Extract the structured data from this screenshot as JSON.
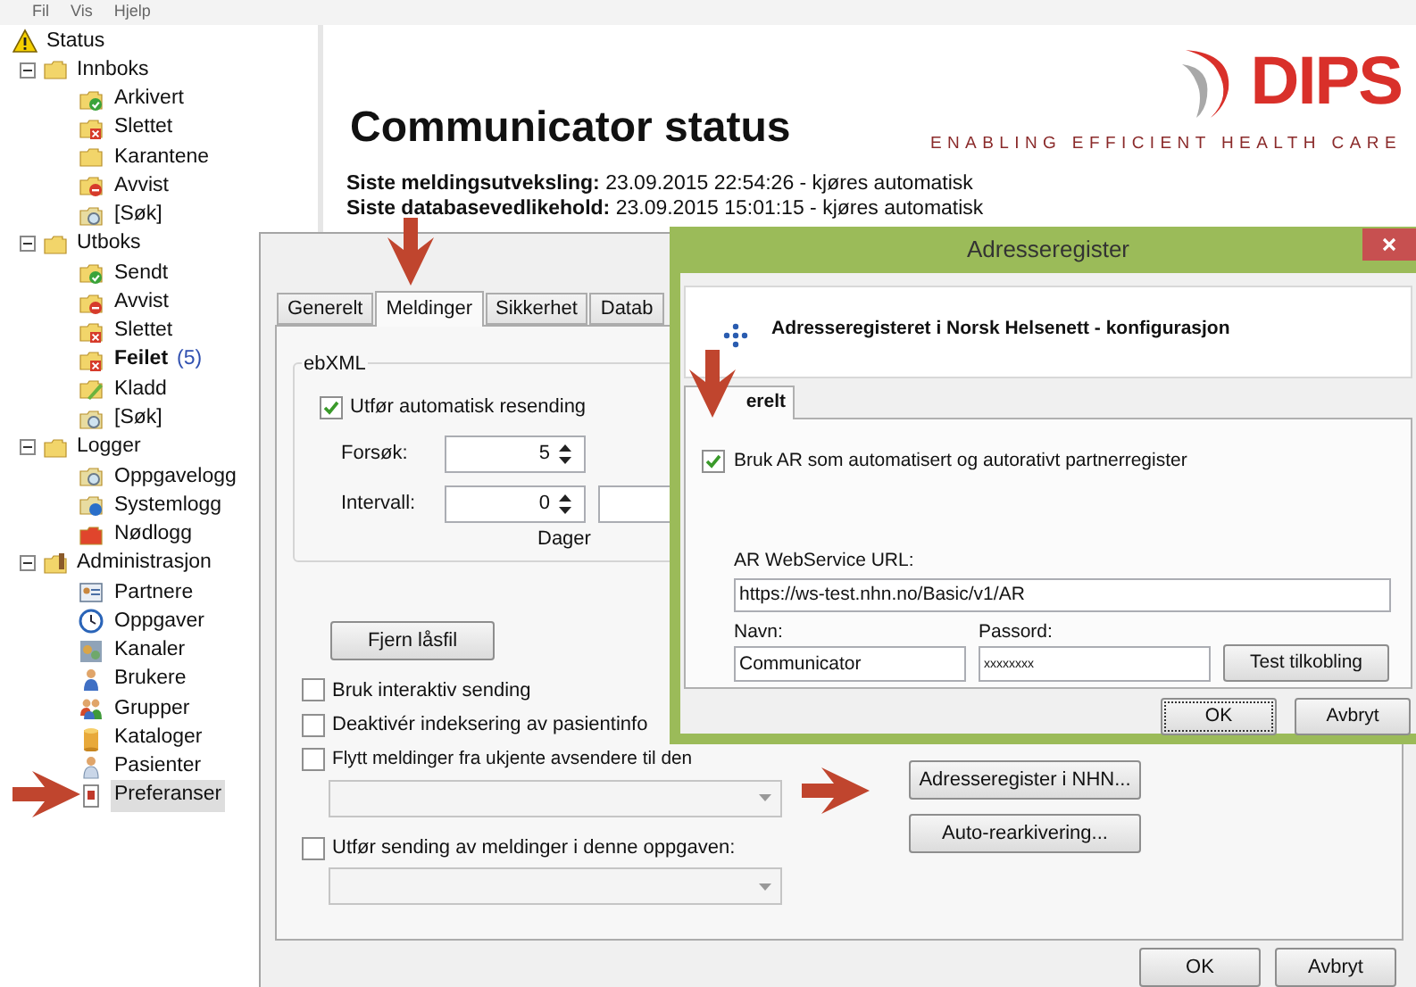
{
  "menu": [
    "Fil",
    "Vis",
    "Hjelp"
  ],
  "tree": [
    {
      "label": "Status",
      "kind": "warning",
      "selected": false,
      "bold": false
    },
    {
      "label": "Innboks",
      "kind": "folder",
      "selected": false,
      "bold": false,
      "expanded": true,
      "children": [
        {
          "label": "Arkivert",
          "kind": "check",
          "selected": false,
          "bold": false
        },
        {
          "label": "Slettet",
          "kind": "cross",
          "selected": false,
          "bold": false
        },
        {
          "label": "Karantene",
          "kind": "folder",
          "selected": false,
          "bold": false
        },
        {
          "label": "Avvist",
          "kind": "minus",
          "selected": false,
          "bold": false
        },
        {
          "label": "[Søk]",
          "kind": "search",
          "selected": false,
          "bold": false
        }
      ]
    },
    {
      "label": "Utboks",
      "kind": "folder",
      "selected": false,
      "bold": false,
      "expanded": true,
      "children": [
        {
          "label": "Sendt",
          "kind": "check",
          "selected": false,
          "bold": false
        },
        {
          "label": "Avvist",
          "kind": "minus",
          "selected": false,
          "bold": false
        },
        {
          "label": "Slettet",
          "kind": "cross",
          "selected": false,
          "bold": false
        },
        {
          "label": "Feilet",
          "kind": "cross",
          "selected": false,
          "bold": true,
          "count": "(5)"
        },
        {
          "label": "Kladd",
          "kind": "edit",
          "selected": false,
          "bold": false
        },
        {
          "label": "[Søk]",
          "kind": "search",
          "selected": false,
          "bold": false
        }
      ]
    },
    {
      "label": "Logger",
      "kind": "folder",
      "selected": false,
      "bold": false,
      "expanded": true,
      "children": [
        {
          "label": "Oppgavelogg",
          "kind": "search",
          "selected": false,
          "bold": false
        },
        {
          "label": "Systemlogg",
          "kind": "info",
          "selected": false,
          "bold": false
        },
        {
          "label": "Nødlogg",
          "kind": "alert",
          "selected": false,
          "bold": false
        }
      ]
    },
    {
      "label": "Administrasjon",
      "kind": "admin",
      "selected": false,
      "bold": false,
      "expanded": true,
      "children": [
        {
          "label": "Partnere",
          "kind": "card",
          "selected": false,
          "bold": false
        },
        {
          "label": "Oppgaver",
          "kind": "clock",
          "selected": false,
          "bold": false
        },
        {
          "label": "Kanaler",
          "kind": "network",
          "selected": false,
          "bold": false
        },
        {
          "label": "Brukere",
          "kind": "user",
          "selected": false,
          "bold": false
        },
        {
          "label": "Grupper",
          "kind": "group",
          "selected": false,
          "bold": false
        },
        {
          "label": "Kataloger",
          "kind": "cylinder",
          "selected": false,
          "bold": false
        },
        {
          "label": "Pasienter",
          "kind": "patient",
          "selected": false,
          "bold": false
        },
        {
          "label": "Preferanser",
          "kind": "document",
          "selected": true,
          "bold": false
        }
      ]
    }
  ],
  "status_page": {
    "title": "Communicator status",
    "logo": "DIPS",
    "tagline": "ENABLING EFFICIENT HEALTH CARE",
    "lines": [
      "**Siste meldingsutveksling:** 23.09.2015 22:54:26 - kjøres automatisk",
      "**Siste databasevedlikehold:** 23.09.2015 15:01:15 - kjøres automatisk"
    ]
  },
  "preferences": {
    "tabs": [
      {
        "label": "Generelt",
        "selected": false
      },
      {
        "label": "Meldinger",
        "selected": true
      },
      {
        "label": "Sikkerhet",
        "selected": false
      },
      {
        "label": "Datab",
        "selected": false
      }
    ],
    "group": {
      "title": "ebXML",
      "resend": {
        "label": "Utfør automatisk resending",
        "checked": true
      },
      "fields": [
        {
          "label": "Forsøk:",
          "value": "5"
        },
        {
          "label": "Intervall:",
          "value": "0"
        }
      ],
      "unit": "Dager"
    },
    "unlock_button": "Fjern låsfil",
    "options": [
      {
        "kind": "checkbox",
        "label": "Bruk interaktiv sending",
        "checked": false
      },
      {
        "kind": "checkbox",
        "label": "Deaktivér indeksering av pasientinfo",
        "checked": false
      },
      {
        "kind": "checkbox_dropdown",
        "label": "Flytt meldinger fra ukjente avsendere til den",
        "checked": false
      },
      {
        "kind": "checkbox_dropdown",
        "label": "Utfør sending av meldinger i denne oppgaven:",
        "checked": false
      }
    ],
    "side_buttons": [
      "Adresseregister i NHN...",
      "Auto-rearkivering..."
    ],
    "buttons": [
      "OK",
      "Avbryt"
    ]
  },
  "address_register": {
    "title": "Adresseregister",
    "heading": "Adresseregisteret i Norsk Helsenett - konfigurasjon",
    "tabs": [
      {
        "label": "erelt",
        "selected": true
      }
    ],
    "use_ar": {
      "label": "Bruk AR som automatisert og autorativt partnerregister",
      "checked": true
    },
    "url": {
      "label": "AR WebService URL:",
      "value": "https://ws-test.nhn.no/Basic/v1/AR"
    },
    "name": {
      "label": "Navn:",
      "value": "Communicator"
    },
    "password": {
      "label": "Passord:",
      "value": "xxxxxxxx"
    },
    "test_button": "Test tilkobling",
    "buttons": [
      {
        "label": "OK",
        "focused": true
      },
      {
        "label": "Avbryt",
        "focused": false
      }
    ]
  }
}
